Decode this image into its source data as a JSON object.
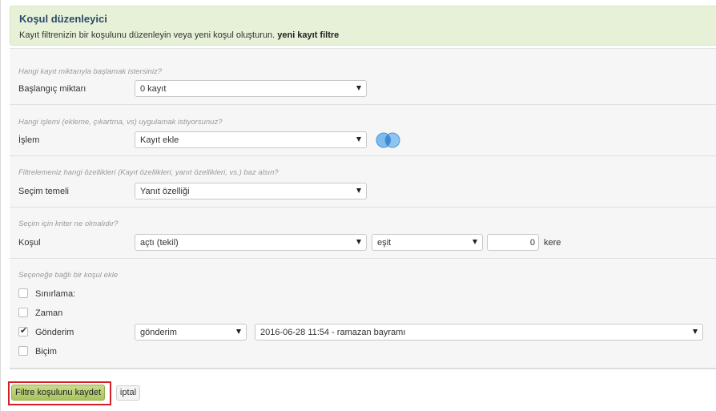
{
  "header": {
    "title": "Koşul düzenleyici",
    "subtitle": "Kayıt filtrenizin bir koşulunu düzenleyin veya yeni koşul oluşturun.",
    "subtitle_bold": "yeni kayıt filtre"
  },
  "sections": {
    "start": {
      "question": "Hangi kayıt miktarıyla başlamak istersiniz?",
      "label": "Başlangıç miktarı",
      "value": "0 kayıt"
    },
    "operation": {
      "question": "Hangi işlemi (ekleme, çıkartma, vs) uygulamak istiyorsunuz?",
      "label": "İşlem",
      "value": "Kayıt ekle",
      "icon": "venn-diagram-icon"
    },
    "basis": {
      "question": "Filtrelemeniz hangi özellikleri (Kayıt özellikleri, yanıt özellikleri, vs.) baz alsın?",
      "label": "Seçim temeli",
      "value": "Yanıt özelliği"
    },
    "criteria": {
      "question": "Seçim için kriter ne olmalıdır?",
      "label": "Koşul",
      "value": "açtı (tekil)",
      "operator": "eşit",
      "count": "0",
      "unit": "kere"
    },
    "sub": {
      "question": "Seçeneğe bağlı bir koşul ekle",
      "options": [
        {
          "label": "Sınırlama:",
          "checked": false
        },
        {
          "label": "Zaman",
          "checked": false
        },
        {
          "label": "Gönderim",
          "checked": true
        },
        {
          "label": "Biçim",
          "checked": false
        }
      ],
      "gonderim_select": "gönderim",
      "gonderim_value": "2016-06-28 11:54 - ramazan bayramı"
    }
  },
  "buttons": {
    "save": "Filtre koşulunu kaydet",
    "cancel": "iptal"
  },
  "colors": {
    "header_bg": "#e6f1d8",
    "save_bg": "#b5cd6e",
    "highlight": "#d41f26",
    "venn": "#5aa7e6"
  }
}
